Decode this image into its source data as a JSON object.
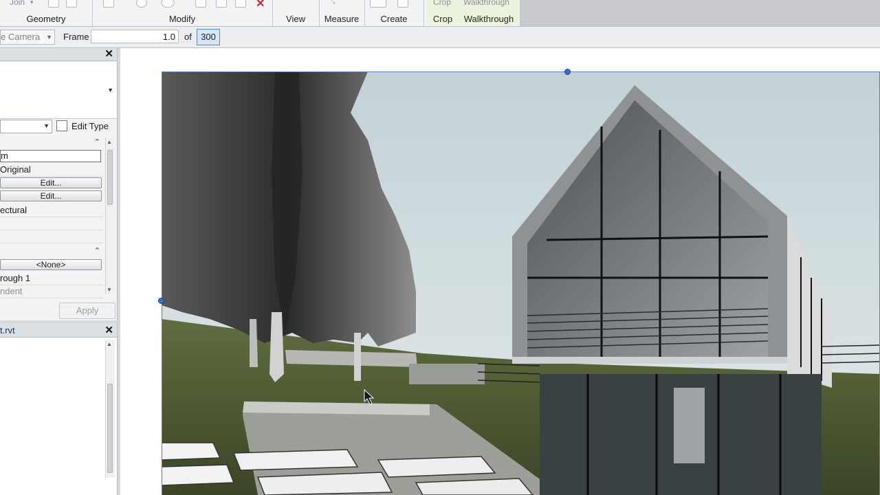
{
  "ribbon": {
    "tools_row": {
      "join": "Join",
      "crop": "Crop",
      "walkthrough": "Walkthrough"
    },
    "panels": {
      "geometry": "Geometry",
      "modify": "Modify",
      "view": "View",
      "measure": "Measure",
      "create": "Create",
      "crop": "Crop",
      "walkthrough": "Walkthrough"
    }
  },
  "options_bar": {
    "camera": "e Camera",
    "frame_label": "Frame",
    "frame_value": "1.0",
    "of_label": "of",
    "total_frames": "300"
  },
  "properties": {
    "edit_type": "Edit Type",
    "rows": {
      "name_field": "m",
      "original": "Original",
      "edit_1": "Edit...",
      "edit_2": "Edit...",
      "architectural": "ectural",
      "none_button": "<None>",
      "walkthrough_name": "rough 1",
      "dependent": "ndent"
    },
    "apply": "Apply"
  },
  "project_browser": {
    "title": "t.rvt"
  },
  "colors": {
    "context_tab": "#ecf3de",
    "grip": "#3b6fc6",
    "selection_blue": "#d6e5f7"
  }
}
